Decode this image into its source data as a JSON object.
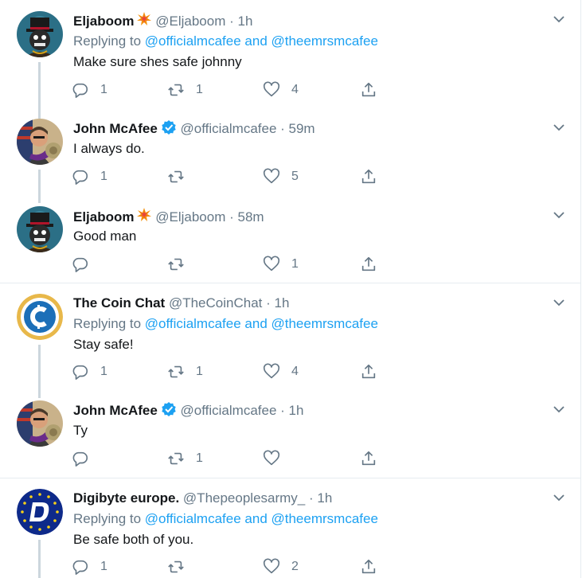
{
  "tweets": [
    {
      "name": "Eljaboom",
      "has_emoji": true,
      "verified": false,
      "handle_time": "@Eljaboom · 1h",
      "replying": {
        "prefix": "Replying to",
        "to": "@officialmcafee and @theemrsmcafee"
      },
      "text": "Make sure shes safe johnny",
      "reply_count": "1",
      "retweet_count": "1",
      "like_count": "4",
      "avatar": "eljaboom"
    },
    {
      "name": "John McAfee",
      "has_emoji": false,
      "verified": true,
      "handle_time": "@officialmcafee · 59m",
      "replying": null,
      "text": "I always do.",
      "reply_count": "1",
      "retweet_count": "",
      "like_count": "5",
      "avatar": "mcafee"
    },
    {
      "name": "Eljaboom",
      "has_emoji": true,
      "verified": false,
      "handle_time": "@Eljaboom · 58m",
      "replying": null,
      "text": "Good man",
      "reply_count": "",
      "retweet_count": "",
      "like_count": "1",
      "avatar": "eljaboom"
    },
    {
      "name": "The Coin Chat",
      "has_emoji": false,
      "verified": false,
      "handle_time": "@TheCoinChat · 1h",
      "replying": {
        "prefix": "Replying to",
        "to": "@officialmcafee and @theemrsmcafee"
      },
      "text": "Stay safe!",
      "reply_count": "1",
      "retweet_count": "1",
      "like_count": "4",
      "avatar": "coinchat"
    },
    {
      "name": "John McAfee",
      "has_emoji": false,
      "verified": true,
      "handle_time": "@officialmcafee · 1h",
      "replying": null,
      "text": "Ty",
      "reply_count": "",
      "retweet_count": "1",
      "like_count": "",
      "avatar": "mcafee"
    },
    {
      "name": "Digibyte europe.",
      "has_emoji": false,
      "verified": false,
      "handle_time": "@Thepeoplesarmy_ · 1h",
      "replying": {
        "prefix": "Replying to",
        "to": "@officialmcafee and @theemrsmcafee"
      },
      "text": "Be safe both of you.",
      "reply_count": "1",
      "retweet_count": "",
      "like_count": "2",
      "avatar": "digibyte"
    }
  ],
  "icons": {
    "reply": "reply-icon",
    "retweet": "retweet-icon",
    "like": "heart-icon",
    "share": "share-icon",
    "more": "chevron-down-icon",
    "verified": "verified-badge-icon",
    "emoji": "collision-emoji-icon"
  },
  "colors": {
    "link": "#1da1f2",
    "muted": "#657786",
    "text": "#14171a",
    "thread_line": "#ccd6dd",
    "separator": "#e6ecf0"
  }
}
